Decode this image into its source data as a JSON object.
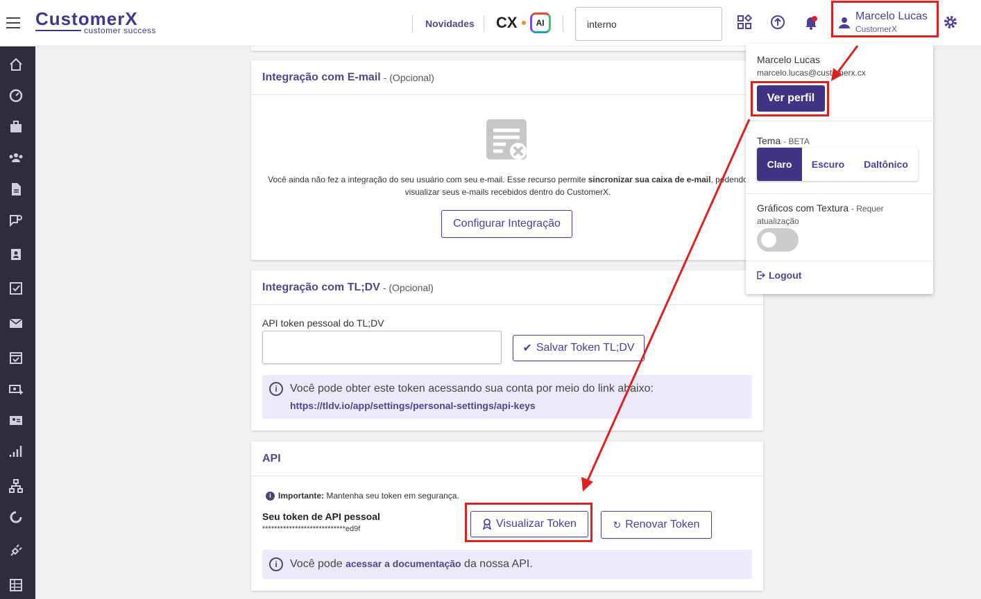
{
  "header": {
    "brand_main": "CustomerX",
    "brand_sub": "customer success",
    "news_label": "Novidades",
    "cx_label": "CX",
    "ai_label": "AI",
    "search_value": "interno",
    "user_name": "Marcelo Lucas",
    "user_org": "CustomerX"
  },
  "email_card": {
    "title": "Integração com E-mail",
    "optional": "- (Opcional)",
    "text_pre": "Você ainda não fez a integração do seu usuário com seu e-mail. Esse recurso permite ",
    "text_bold": "sincronizar sua caixa de e-mail",
    "text_post": ", podendo visualizar seus e-mails recebidos dentro do CustomerX.",
    "button": "Configurar Integração"
  },
  "tldv_card": {
    "title": "Integração com TL;DV",
    "optional": "- (Opcional)",
    "field_label": "API token pessoal do TL;DV",
    "field_value": "",
    "save_button": "Salvar Token TL;DV",
    "info_text": "Você pode obter este token acessando sua conta por meio do link abaixo:",
    "info_link": "https://tldv.io/app/settings/personal-settings/api-keys"
  },
  "api_card": {
    "title": "API",
    "important_label": "Importante:",
    "important_text": "Mantenha seu token em segurança.",
    "token_label": "Seu token de API pessoal",
    "token_masked": "****************************ed9f",
    "view_button": "Visualizar Token",
    "renew_button": "Renovar Token",
    "doc_pre": "Você pode ",
    "doc_link": "acessar a documentação",
    "doc_post": " da nossa API."
  },
  "dropdown": {
    "name": "Marcelo Lucas",
    "email": "marcelo.lucas@customerx.cx",
    "profile_button": "Ver perfil",
    "theme_label": "Tema",
    "theme_beta": "- BETA",
    "themes": [
      "Claro",
      "Escuro",
      "Daltônico"
    ],
    "texture_label": "Gráficos com Textura",
    "texture_note": "- Requer",
    "texture_note2": "atualização",
    "texture_enabled": false,
    "logout": "Logout"
  },
  "colors": {
    "primary": "#4b3f9a",
    "primary_dark": "#3f3584",
    "sidebar": "#2d2d3c",
    "annotation": "#e0201e",
    "info_bg": "#ece9fb",
    "notification": "#e0201e"
  }
}
